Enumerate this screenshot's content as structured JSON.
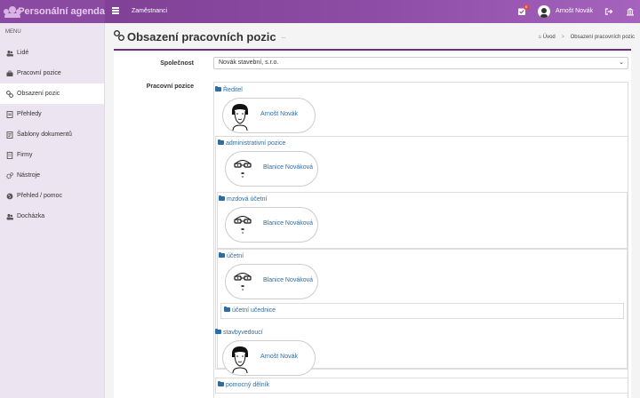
{
  "app": {
    "title": "Personální agenda"
  },
  "topbar": {
    "nav_item": "Zaměstnanci",
    "notification_count": "6",
    "user_name": "Arnošt Novák"
  },
  "sidebar": {
    "menu_heading": "MENU",
    "items": [
      {
        "label": "Lidé",
        "icon": "users-icon"
      },
      {
        "label": "Pracovní pozice",
        "icon": "briefcase-icon"
      },
      {
        "label": "Obsazení pozic",
        "icon": "link-icon"
      },
      {
        "label": "Přehledy",
        "icon": "document-icon"
      },
      {
        "label": "Šablony dokumentů",
        "icon": "file-text-icon"
      },
      {
        "label": "Firmy",
        "icon": "building-icon"
      },
      {
        "label": "Nástroje",
        "icon": "cogs-icon"
      },
      {
        "label": "Přehled / pomoc",
        "icon": "globe-icon"
      },
      {
        "label": "Docházka",
        "icon": "users-icon"
      }
    ]
  },
  "page": {
    "title": "Obsazení pracovních pozic",
    "title_suffix": "..."
  },
  "breadcrumb": {
    "home": "Úvod",
    "current": "Obsazení pracovních pozic"
  },
  "form": {
    "company_label": "Společnost",
    "company_value": "Novák stavební, s.r.o.",
    "positions_label": "Pracovní pozice"
  },
  "tree": {
    "director": {
      "label": "Ředitel",
      "person": "Arnošt Novák"
    },
    "admin": {
      "label": "administrativní pozice",
      "person": "Blanice Nováková"
    },
    "payroll": {
      "label": "mzdová účetní",
      "person": "Blanice Nováková"
    },
    "accountant": {
      "label": "účetní",
      "person": "Blanice Nováková"
    },
    "apprentice": {
      "label": "účetní učednice"
    },
    "site_manager": {
      "label": "stavbyvedoucí",
      "person": "Arnošt Novák"
    },
    "helper": {
      "label": "pomocný dělník"
    }
  },
  "colors": {
    "accent": "#8e4da6",
    "link": "#2e6da4",
    "title_line": "#6a2f80"
  }
}
